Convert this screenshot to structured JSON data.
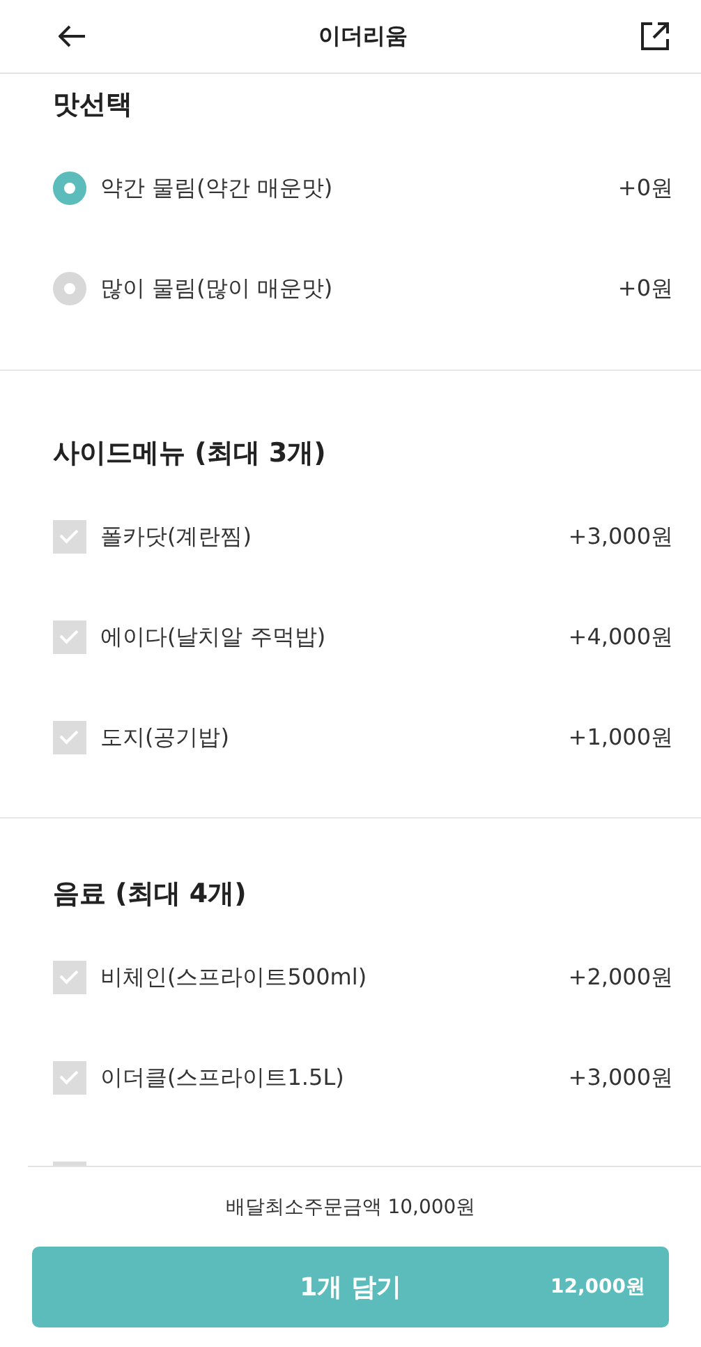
{
  "header": {
    "title": "이더리움"
  },
  "sections": [
    {
      "title": "맛선택",
      "kind": "radio",
      "options": [
        {
          "label": "약간 물림(약간 매운맛)",
          "price": "+0원",
          "selected": true
        },
        {
          "label": "많이 물림(많이 매운맛)",
          "price": "+0원",
          "selected": false
        }
      ]
    },
    {
      "title": "사이드메뉴 (최대 3개)",
      "kind": "checkbox",
      "options": [
        {
          "label": "폴카닷(계란찜)",
          "price": "+3,000원",
          "checked": false
        },
        {
          "label": "에이다(날치알 주먹밥)",
          "price": "+4,000원",
          "checked": false
        },
        {
          "label": "도지(공기밥)",
          "price": "+1,000원",
          "checked": false
        }
      ]
    },
    {
      "title": "음료 (최대 4개)",
      "kind": "checkbox",
      "options": [
        {
          "label": "비체인(스프라이트500ml)",
          "price": "+2,000원",
          "checked": false
        },
        {
          "label": "이더클(스프라이트1.5L)",
          "price": "+3,000원",
          "checked": false
        },
        {
          "checked": false
        }
      ]
    }
  ],
  "footer": {
    "min_order": "배달최소주문금액 10,000원",
    "button": {
      "label": "1개 담기",
      "price": "12,000원"
    }
  }
}
